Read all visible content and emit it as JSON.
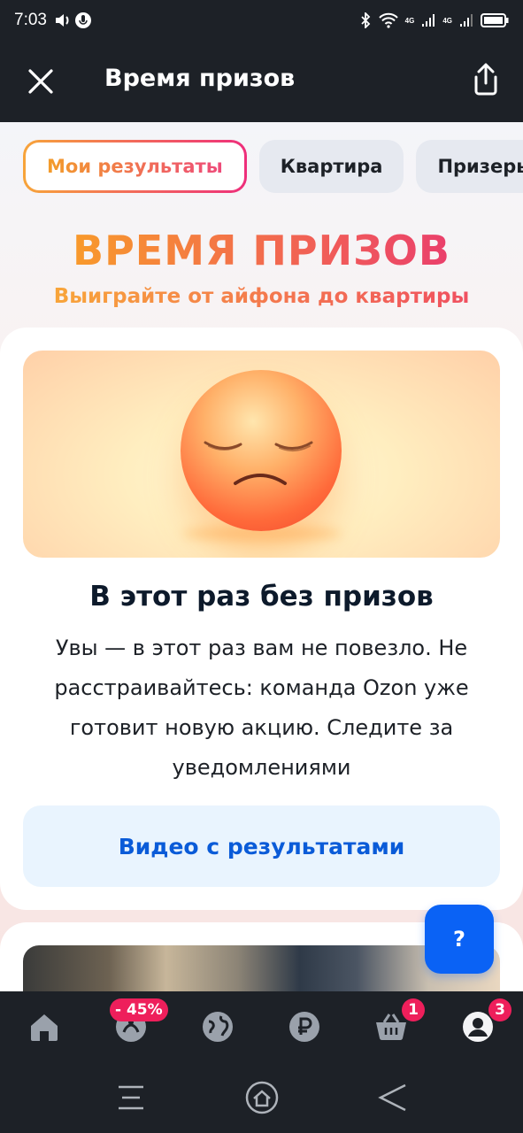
{
  "status_bar": {
    "time": "7:03",
    "network_labels": [
      "4G",
      "4G"
    ]
  },
  "header": {
    "title": "Время призов",
    "close_icon": "close-icon",
    "share_icon": "share-icon"
  },
  "tabs": [
    {
      "label": "Мои результаты",
      "active": true
    },
    {
      "label": "Квартира",
      "active": false
    },
    {
      "label": "Призеры",
      "active": false
    }
  ],
  "hero": {
    "title": "ВРЕМЯ ПРИЗОВ",
    "subtitle": "Выиграйте от айфона до квартиры"
  },
  "result_card": {
    "emoji_icon": "pensive-face-emoji",
    "title": "В этот раз без призов",
    "text": "Увы — в этот раз вам не повезло. Не расстраивайтесь: команда Ozon уже готовит новую акцию. Следите за уведомлениями",
    "video_button_label": "Видео с результатами"
  },
  "help_button": {
    "label": "?"
  },
  "bottom_nav": {
    "items": [
      {
        "icon": "home-icon"
      },
      {
        "icon": "fresh-icon",
        "badge": "- 45%"
      },
      {
        "icon": "globe-icon"
      },
      {
        "icon": "ruble-icon"
      },
      {
        "icon": "cart-icon",
        "badge": "1"
      },
      {
        "icon": "profile-icon",
        "badge": "3"
      }
    ]
  },
  "colors": {
    "header_bg": "#1d2127",
    "accent_blue": "#0a62f5",
    "badge_pink": "#ee1f5b",
    "gradient_start": "#f89a2b",
    "gradient_end": "#ea3f6b"
  }
}
